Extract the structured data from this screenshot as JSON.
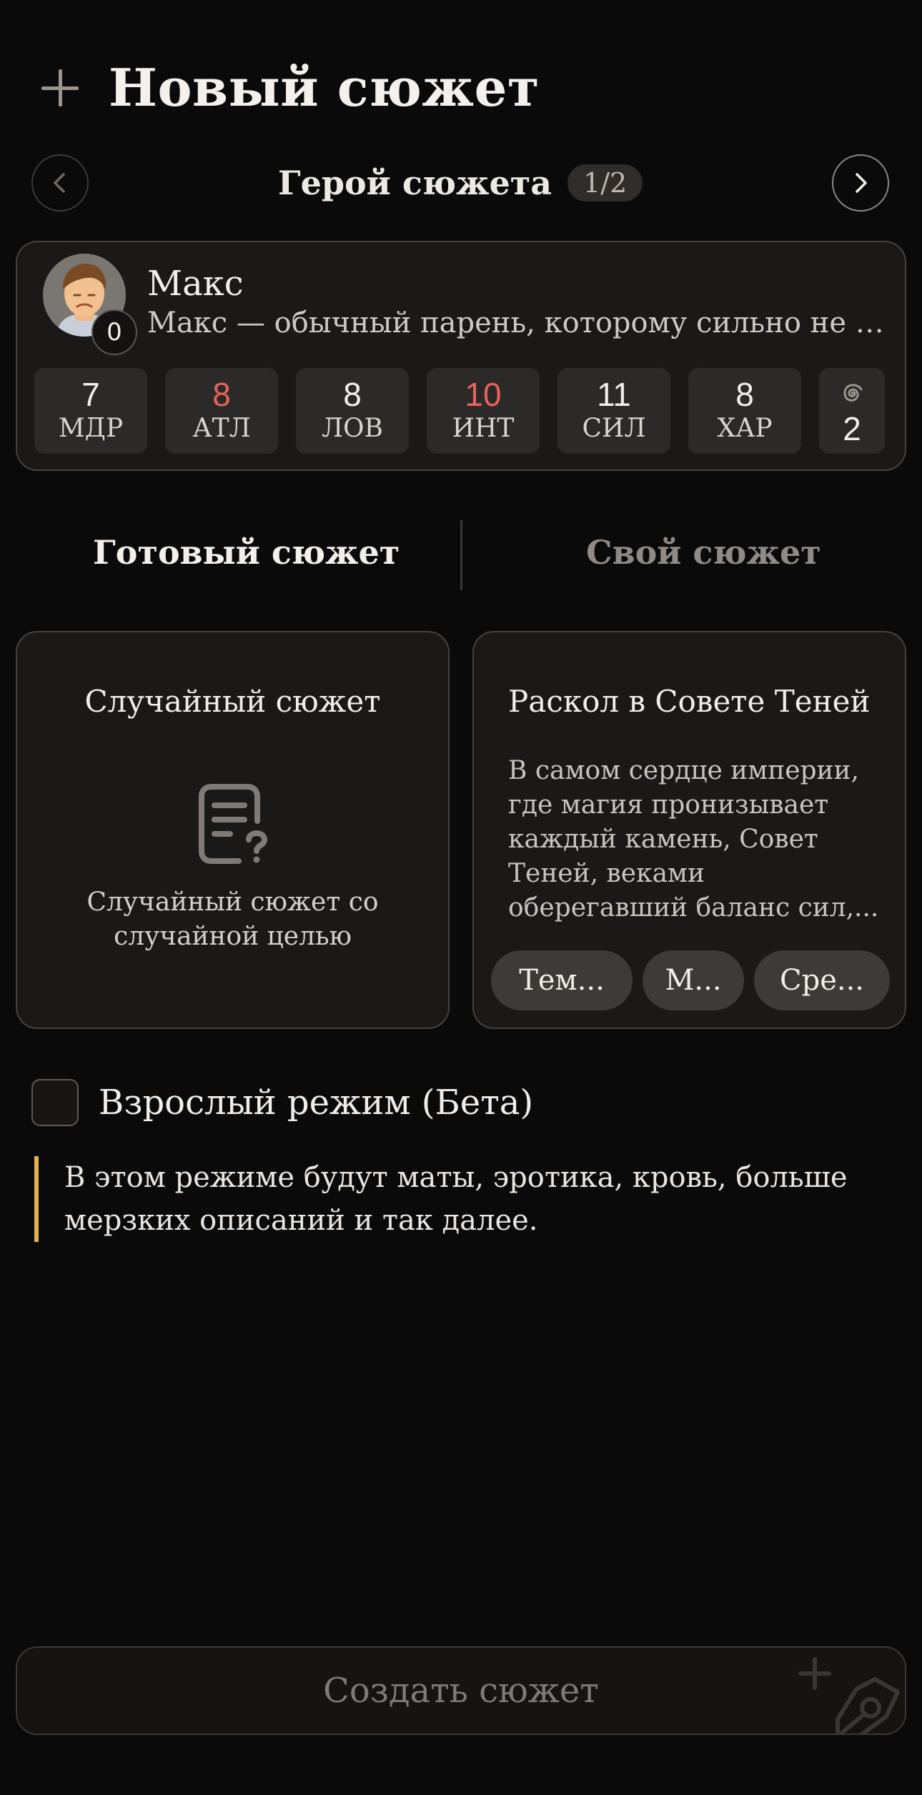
{
  "header": {
    "title": "Новый сюжет",
    "icon": "plus-icon"
  },
  "hero_nav": {
    "title": "Герой сюжета",
    "counter": "1/2"
  },
  "hero": {
    "name": "Макс",
    "description": "Макс — обычный парень, которому сильно не повезло в жизни, но он не сдаётся",
    "level": "0",
    "stats": [
      {
        "value": "7",
        "label": "МДР",
        "highlight": false
      },
      {
        "value": "8",
        "label": "АТЛ",
        "highlight": true
      },
      {
        "value": "8",
        "label": "ЛОВ",
        "highlight": false
      },
      {
        "value": "10",
        "label": "ИНТ",
        "highlight": true
      },
      {
        "value": "11",
        "label": "СИЛ",
        "highlight": false
      },
      {
        "value": "8",
        "label": "ХАР",
        "highlight": false
      }
    ],
    "extra_stat": {
      "icon": "spiral-icon",
      "value": "2"
    }
  },
  "tabs": {
    "ready": "Готовый сюжет",
    "custom": "Свой сюжет"
  },
  "random_card": {
    "title": "Случайный сюжет",
    "icon": "question-document-icon",
    "description": "Случайный сюжет со случайной целью"
  },
  "story_card": {
    "title": "Раскол в Совете Теней",
    "description": "В самом сердце империи, где магия пронизывает каждый камень, Совет Теней, веками оберегавший баланс сил,...",
    "tags": [
      "Тем...",
      "М...",
      "Сре..."
    ]
  },
  "adult_mode": {
    "label": "Взрослый режим (Бета)",
    "checked": false,
    "note": "В этом режиме будут маты, эротика, кровь, больше мерзких описаний и так далее."
  },
  "create_button": {
    "label": "Создать сюжет"
  },
  "colors": {
    "background": "#0b0a0a",
    "card": "#1b1918",
    "stat_highlight": "#e7625e",
    "note_accent": "#e8b04c"
  }
}
